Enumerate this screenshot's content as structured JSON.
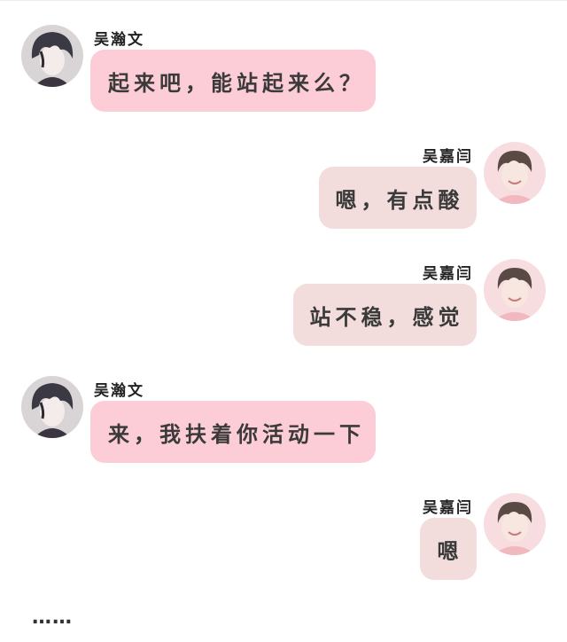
{
  "chat": {
    "messages": [
      {
        "sender": "吴瀚文",
        "side": "left",
        "text": "起来吧，能站起来么？"
      },
      {
        "sender": "吴嘉闫",
        "side": "right",
        "text": "嗯，有点酸"
      },
      {
        "sender": "吴嘉闫",
        "side": "right",
        "text": "站不稳，感觉"
      },
      {
        "sender": "吴瀚文",
        "side": "left",
        "text": "来，我扶着你活动一下"
      },
      {
        "sender": "吴嘉闫",
        "side": "right",
        "text": "嗯"
      }
    ],
    "trailing_text": "……"
  },
  "colors": {
    "left_bubble": "#fcccd7",
    "right_bubble": "#f2dcdc",
    "text": "#3a3a3a"
  },
  "icons": {
    "left_avatar": "dark-haired-boy-avatar-icon",
    "right_avatar": "smiling-boy-pink-avatar-icon"
  }
}
